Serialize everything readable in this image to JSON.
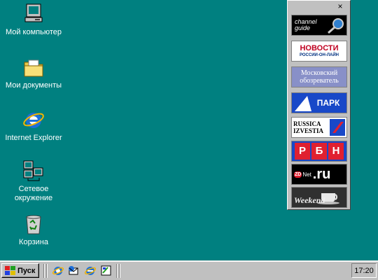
{
  "desktop": {
    "icons": [
      {
        "label": "Мой компьютер",
        "icon": "my-computer-icon"
      },
      {
        "label": "Мои документы",
        "icon": "my-documents-folder-icon"
      },
      {
        "label": "Internet Explorer",
        "icon": "internet-explorer-icon"
      },
      {
        "label": "Сетевое\nокружение",
        "icon": "network-neighborhood-icon"
      },
      {
        "label": "Корзина",
        "icon": "recycle-bin-icon"
      }
    ]
  },
  "channel_bar": {
    "close_glyph": "×",
    "channels": [
      {
        "line1": "channel",
        "line2": "guide"
      },
      {
        "line1": "НОВОСТИ",
        "line2": "РОССИИ-ОН-ЛАЙН"
      },
      {
        "line1": "Московский",
        "line2": "обозреватель"
      },
      {
        "line1": "ПАРК"
      },
      {
        "line1": "RUSSICA",
        "line2": "IZVESTIA"
      },
      {
        "letters": [
          "Р",
          "Б",
          "Н"
        ]
      },
      {
        "line1": "ZD",
        "line2": "Net",
        "line3": ".ru"
      },
      {
        "line1": "Weekend"
      }
    ]
  },
  "taskbar": {
    "start_label": "Пуск",
    "clock": "17:20",
    "quick_launch": [
      "ie-quicklaunch-icon",
      "outlook-express-icon",
      "desktop-ie-icon",
      "show-desktop-icon"
    ]
  }
}
